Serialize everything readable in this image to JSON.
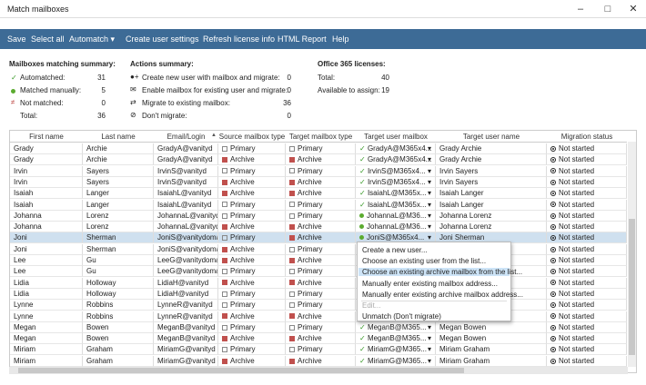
{
  "window": {
    "title": "Match mailboxes"
  },
  "toolbar": {
    "save": "Save",
    "select_all": "Select all",
    "automatch": "Automatch",
    "create_user_settings": "Create user settings",
    "refresh_license": "Refresh license info",
    "html_report": "HTML Report",
    "help": "Help"
  },
  "mailbox_summary": {
    "heading": "Mailboxes matching summary:",
    "automatched_label": "Automatched:",
    "automatched": "31",
    "manual_label": "Matched manually:",
    "manual": "5",
    "not_matched_label": "Not matched:",
    "not_matched": "0",
    "total_label": "Total:",
    "total": "36"
  },
  "actions_summary": {
    "heading": "Actions summary:",
    "create_label": "Create new user with mailbox and migrate:",
    "create": "0",
    "enable_label": "Enable mailbox for existing user and migrate:",
    "enable": "0",
    "migrate_label": "Migrate to existing mailbox:",
    "migrate": "36",
    "dont_label": "Don't migrate:",
    "dont": "0"
  },
  "licenses": {
    "heading": "Office 365 licenses:",
    "total_label": "Total:",
    "total": "40",
    "available_label": "Available to assign:",
    "available": "19"
  },
  "columns": [
    "First name",
    "Last name",
    "Email/Login",
    "Source mailbox type",
    "Target mailbox type",
    "Target user mailbox",
    "Target user name",
    "Migration status"
  ],
  "rows": [
    [
      "Grady",
      "Archie",
      "GradyA@vanityd",
      "Primary",
      "Primary",
      "GradyA@M365x4...",
      "Grady Archie",
      "Not started"
    ],
    [
      "Grady",
      "Archie",
      "GradyA@vanityd",
      "Archive",
      "Archive",
      "GradyA@M365x4...",
      "Grady Archie",
      "Not started"
    ],
    [
      "Irvin",
      "Sayers",
      "IrvinS@vanityd",
      "Primary",
      "Primary",
      "IrvinS@M365x4...",
      "Irvin Sayers",
      "Not started"
    ],
    [
      "Irvin",
      "Sayers",
      "IrvinS@vanityd",
      "Archive",
      "Archive",
      "IrvinS@M365x4...",
      "Irvin Sayers",
      "Not started"
    ],
    [
      "Isaiah",
      "Langer",
      "IsaiahL@vanityd",
      "Archive",
      "Archive",
      "IsaiahL@M365x...",
      "Isaiah Langer",
      "Not started"
    ],
    [
      "Isaiah",
      "Langer",
      "IsaiahL@vanityd",
      "Primary",
      "Primary",
      "IsaiahL@M365x...",
      "Isaiah Langer",
      "Not started"
    ],
    [
      "Johanna",
      "Lorenz",
      "JohannaL@vanityd",
      "Primary",
      "Primary",
      "JohannaL@M36...",
      "Johanna Lorenz",
      "Not started"
    ],
    [
      "Johanna",
      "Lorenz",
      "JohannaL@vanityd",
      "Archive",
      "Archive",
      "JohannaL@M36...",
      "Johanna Lorenz",
      "Not started"
    ],
    [
      "Joni",
      "Sherman",
      "JoniS@vanitydoma",
      "Primary",
      "Archive",
      "JoniS@M365x4...",
      "Joni Sherman",
      "Not started"
    ],
    [
      "Joni",
      "Sherman",
      "JoniS@vanitydoma",
      "Archive",
      "Primary",
      "",
      "",
      "Not started"
    ],
    [
      "Lee",
      "Gu",
      "LeeG@vanitydoma",
      "Archive",
      "Archive",
      "",
      "",
      "Not started"
    ],
    [
      "Lee",
      "Gu",
      "LeeG@vanitydoma",
      "Primary",
      "Primary",
      "",
      "",
      "Not started"
    ],
    [
      "Lidia",
      "Holloway",
      "LidiaH@vanityd",
      "Archive",
      "Archive",
      "",
      "",
      "Not started"
    ],
    [
      "Lidia",
      "Holloway",
      "LidiaH@vanityd",
      "Primary",
      "Primary",
      "",
      "",
      "Not started"
    ],
    [
      "Lynne",
      "Robbins",
      "LynneR@vanityd",
      "Primary",
      "Primary",
      "",
      "",
      "Not started"
    ],
    [
      "Lynne",
      "Robbins",
      "LynneR@vanityd",
      "Archive",
      "Archive",
      "",
      "",
      "Not started"
    ],
    [
      "Megan",
      "Bowen",
      "MeganB@vanityd",
      "Primary",
      "Primary",
      "MeganB@M365...",
      "Megan Bowen",
      "Not started"
    ],
    [
      "Megan",
      "Bowen",
      "MeganB@vanityd",
      "Archive",
      "Archive",
      "MeganB@M365...",
      "Megan Bowen",
      "Not started"
    ],
    [
      "Miriam",
      "Graham",
      "MiriamG@vanityd",
      "Primary",
      "Primary",
      "MiriamG@M365...",
      "Miriam Graham",
      "Not started"
    ],
    [
      "Miriam",
      "Graham",
      "MiriamG@vanityd",
      "Archive",
      "Archive",
      "MiriamG@M365...",
      "Miriam Graham",
      "Not started"
    ]
  ],
  "context_menu": [
    "Create a new user...",
    "Choose an existing user from the list...",
    "Choose an existing archive mailbox from the list...",
    "Manually enter existing mailbox address...",
    "Manually enter existing archive mailbox address...",
    "Edit...",
    "Unmatch (Don't migrate)"
  ],
  "colors": {
    "toolbar": "#3d6b96",
    "selected_row": "#cfe0ef",
    "check": "#3a9b2a",
    "archive_icon": "#c0504d"
  }
}
